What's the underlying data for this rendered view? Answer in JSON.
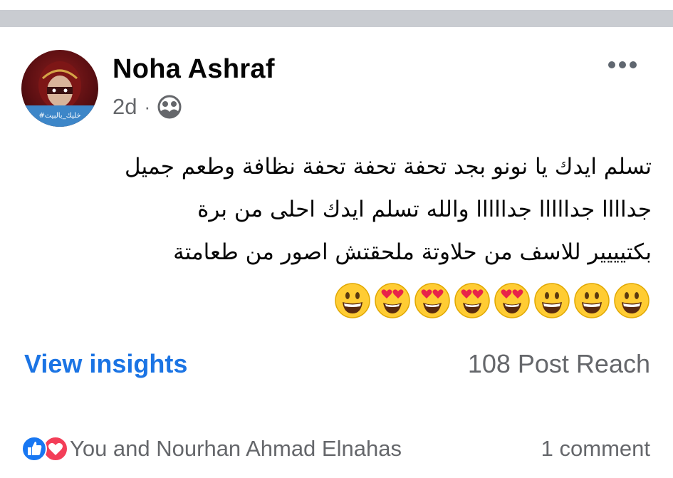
{
  "post": {
    "author": "Noha Ashraf",
    "time": "2d",
    "separator": "·",
    "privacy_icon": "friends-icon",
    "avatar_caption": "#خليك_بالبيت",
    "text_lines": [
      "تسلم ايدك يا نونو بجد تحفة تحفة تحفة نظافة وطعم جميل",
      "جداااا جدااااا جدااااا والله تسلم ايدك احلى من برة",
      "بكتيييير للاسف من حلاوتة ملحقتش اصور من طعامتة"
    ],
    "emojis": [
      "grinning-face",
      "grinning-face",
      "grinning-face",
      "heart-eyes-face",
      "heart-eyes-face",
      "heart-eyes-face",
      "heart-eyes-face",
      "grinning-face"
    ]
  },
  "insights": {
    "link_label": "View insights",
    "reach_label": "108 Post Reach"
  },
  "reactions": {
    "icons": [
      "like-icon",
      "love-icon"
    ],
    "text": "You and Nourhan Ahmad Elnahas",
    "comments": "1 comment"
  },
  "colors": {
    "link_blue": "#1b74e4",
    "secondary_text": "#65676b",
    "divider": "#c9ccd1",
    "like_blue": "#1877f2",
    "love_red": "#f33e58"
  }
}
